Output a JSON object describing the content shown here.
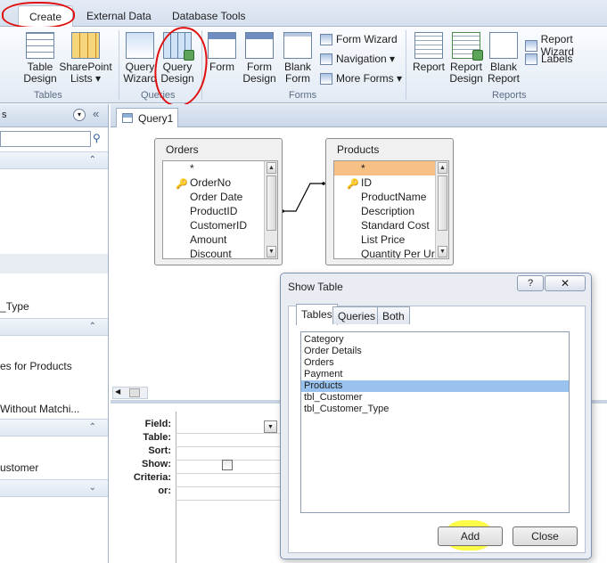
{
  "ribbon": {
    "tabs": [
      {
        "label": "Create"
      },
      {
        "label": "External Data"
      },
      {
        "label": "Database Tools"
      }
    ],
    "groups": {
      "tables": {
        "label": "Tables",
        "table_design": "Table\nDesign",
        "sharepoint_lists": "SharePoint\nLists ▾"
      },
      "queries": {
        "label": "Queries",
        "query_wizard": "Query\nWizard",
        "query_design": "Query\nDesign"
      },
      "forms": {
        "label": "Forms",
        "form": "Form",
        "form_design": "Form\nDesign",
        "blank_form": "Blank\nForm",
        "form_wizard": "Form Wizard",
        "navigation": "Navigation ▾",
        "more_forms": "More Forms ▾"
      },
      "reports": {
        "label": "Reports",
        "report": "Report",
        "report_design": "Report\nDesign",
        "blank_report": "Blank\nReport",
        "report_wizard": "Report Wizard",
        "labels": "Labels"
      }
    }
  },
  "nav_pane": {
    "items": [
      {
        "label": "_Type"
      },
      {
        "label": "es for Products"
      },
      {
        "label": "Without Matchi..."
      },
      {
        "label": "ustomer"
      }
    ]
  },
  "document": {
    "tab_label": "Query1",
    "tables": [
      {
        "name": "Orders",
        "fields": [
          "*",
          "OrderNo",
          "Order Date",
          "ProductID",
          "CustomerID",
          "Amount",
          "Discount"
        ],
        "key_field": "OrderNo"
      },
      {
        "name": "Products",
        "fields": [
          "*",
          "ID",
          "ProductName",
          "Description",
          "Standard Cost",
          "List Price",
          "Quantity Per Ur"
        ],
        "key_field": "ID",
        "selected_field": "*"
      }
    ],
    "qbe_rows": [
      "Field:",
      "Table:",
      "Sort:",
      "Show:",
      "Criteria:",
      "or:"
    ]
  },
  "show_table_dialog": {
    "title": "Show Table",
    "help": "?",
    "tabs": [
      "Tables",
      "Queries",
      "Both"
    ],
    "active_tab": "Tables",
    "tables": [
      "Category",
      "Order Details",
      "Orders",
      "Payment",
      "Products",
      "tbl_Customer",
      "tbl_Customer_Type"
    ],
    "selected": "Products",
    "add_label": "Add",
    "close_label": "Close"
  },
  "colors": {
    "annotation_red": "#e01010",
    "highlight_yellow": "#fafa28",
    "selected_field": "#f7c085",
    "selected_list_item": "#99c2ee"
  }
}
